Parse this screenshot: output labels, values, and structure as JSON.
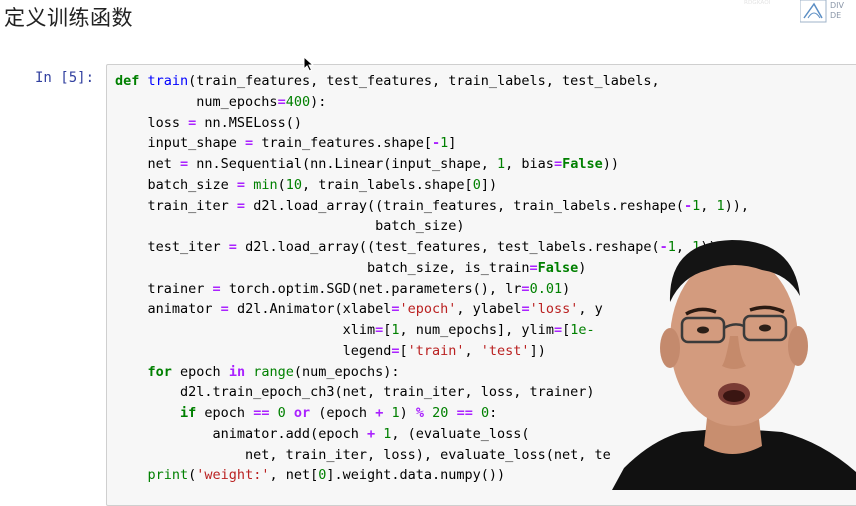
{
  "page": {
    "heading": "定义训练函数",
    "faint_caption": "ᴿᴰᴳᴷᴬᴼᴵ"
  },
  "logo": {
    "text_line1": "DIV",
    "text_line2": "DE"
  },
  "cell": {
    "prompt": "In [5]:",
    "code_lines": [
      [
        {
          "t": "def",
          "c": "kw"
        },
        {
          "t": " ",
          "c": "txt"
        },
        {
          "t": "train",
          "c": "fn"
        },
        {
          "t": "(train_features, test_features, train_labels, test_labels,",
          "c": "txt"
        }
      ],
      [
        {
          "t": "          num_epochs",
          "c": "txt"
        },
        {
          "t": "=",
          "c": "op"
        },
        {
          "t": "400",
          "c": "num"
        },
        {
          "t": "):",
          "c": "txt"
        }
      ],
      [
        {
          "t": "    loss ",
          "c": "txt"
        },
        {
          "t": "=",
          "c": "op"
        },
        {
          "t": " nn.MSELoss()",
          "c": "txt"
        }
      ],
      [
        {
          "t": "    input_shape ",
          "c": "txt"
        },
        {
          "t": "=",
          "c": "op"
        },
        {
          "t": " train_features.shape[",
          "c": "txt"
        },
        {
          "t": "-",
          "c": "op"
        },
        {
          "t": "1",
          "c": "num"
        },
        {
          "t": "]",
          "c": "txt"
        }
      ],
      [
        {
          "t": "    net ",
          "c": "txt"
        },
        {
          "t": "=",
          "c": "op"
        },
        {
          "t": " nn.Sequential(nn.Linear(input_shape, ",
          "c": "txt"
        },
        {
          "t": "1",
          "c": "num"
        },
        {
          "t": ", bias",
          "c": "txt"
        },
        {
          "t": "=",
          "c": "op"
        },
        {
          "t": "False",
          "c": "kw"
        },
        {
          "t": "))",
          "c": "txt"
        }
      ],
      [
        {
          "t": "    batch_size ",
          "c": "txt"
        },
        {
          "t": "=",
          "c": "op"
        },
        {
          "t": " ",
          "c": "txt"
        },
        {
          "t": "min",
          "c": "bi"
        },
        {
          "t": "(",
          "c": "txt"
        },
        {
          "t": "10",
          "c": "num"
        },
        {
          "t": ", train_labels.shape[",
          "c": "txt"
        },
        {
          "t": "0",
          "c": "num"
        },
        {
          "t": "])",
          "c": "txt"
        }
      ],
      [
        {
          "t": "    train_iter ",
          "c": "txt"
        },
        {
          "t": "=",
          "c": "op"
        },
        {
          "t": " d2l.load_array((train_features, train_labels.reshape(",
          "c": "txt"
        },
        {
          "t": "-",
          "c": "op"
        },
        {
          "t": "1",
          "c": "num"
        },
        {
          "t": ", ",
          "c": "txt"
        },
        {
          "t": "1",
          "c": "num"
        },
        {
          "t": ")),",
          "c": "txt"
        }
      ],
      [
        {
          "t": "                                batch_size)",
          "c": "txt"
        }
      ],
      [
        {
          "t": "    test_iter ",
          "c": "txt"
        },
        {
          "t": "=",
          "c": "op"
        },
        {
          "t": " d2l.load_array((test_features, test_labels.reshape(",
          "c": "txt"
        },
        {
          "t": "-",
          "c": "op"
        },
        {
          "t": "1",
          "c": "num"
        },
        {
          "t": ", ",
          "c": "txt"
        },
        {
          "t": "1",
          "c": "num"
        },
        {
          "t": ")),",
          "c": "txt"
        }
      ],
      [
        {
          "t": "                               batch_size, is_train",
          "c": "txt"
        },
        {
          "t": "=",
          "c": "op"
        },
        {
          "t": "False",
          "c": "kw"
        },
        {
          "t": ")",
          "c": "txt"
        }
      ],
      [
        {
          "t": "    trainer ",
          "c": "txt"
        },
        {
          "t": "=",
          "c": "op"
        },
        {
          "t": " torch.optim.SGD(net.parameters(), lr",
          "c": "txt"
        },
        {
          "t": "=",
          "c": "op"
        },
        {
          "t": "0.01",
          "c": "num"
        },
        {
          "t": ")",
          "c": "txt"
        }
      ],
      [
        {
          "t": "    animator ",
          "c": "txt"
        },
        {
          "t": "=",
          "c": "op"
        },
        {
          "t": " d2l.Animator(xlabel",
          "c": "txt"
        },
        {
          "t": "=",
          "c": "op"
        },
        {
          "t": "'epoch'",
          "c": "str"
        },
        {
          "t": ", ylabel",
          "c": "txt"
        },
        {
          "t": "=",
          "c": "op"
        },
        {
          "t": "'loss'",
          "c": "str"
        },
        {
          "t": ", y",
          "c": "txt"
        }
      ],
      [
        {
          "t": "                            xlim",
          "c": "txt"
        },
        {
          "t": "=",
          "c": "op"
        },
        {
          "t": "[",
          "c": "txt"
        },
        {
          "t": "1",
          "c": "num"
        },
        {
          "t": ", num_epochs], ylim",
          "c": "txt"
        },
        {
          "t": "=",
          "c": "op"
        },
        {
          "t": "[",
          "c": "txt"
        },
        {
          "t": "1e-",
          "c": "num"
        }
      ],
      [
        {
          "t": "                            legend",
          "c": "txt"
        },
        {
          "t": "=",
          "c": "op"
        },
        {
          "t": "[",
          "c": "txt"
        },
        {
          "t": "'train'",
          "c": "str"
        },
        {
          "t": ", ",
          "c": "txt"
        },
        {
          "t": "'test'",
          "c": "str"
        },
        {
          "t": "])",
          "c": "txt"
        }
      ],
      [
        {
          "t": "    ",
          "c": "txt"
        },
        {
          "t": "for",
          "c": "kw"
        },
        {
          "t": " epoch ",
          "c": "txt"
        },
        {
          "t": "in",
          "c": "op"
        },
        {
          "t": " ",
          "c": "txt"
        },
        {
          "t": "range",
          "c": "bi"
        },
        {
          "t": "(num_epochs):",
          "c": "txt"
        }
      ],
      [
        {
          "t": "        d2l.train_epoch_ch3(net, train_iter, loss, trainer)",
          "c": "txt"
        }
      ],
      [
        {
          "t": "        ",
          "c": "txt"
        },
        {
          "t": "if",
          "c": "kw"
        },
        {
          "t": " epoch ",
          "c": "txt"
        },
        {
          "t": "==",
          "c": "op"
        },
        {
          "t": " ",
          "c": "txt"
        },
        {
          "t": "0",
          "c": "num"
        },
        {
          "t": " ",
          "c": "txt"
        },
        {
          "t": "or",
          "c": "op"
        },
        {
          "t": " (epoch ",
          "c": "txt"
        },
        {
          "t": "+",
          "c": "op"
        },
        {
          "t": " ",
          "c": "txt"
        },
        {
          "t": "1",
          "c": "num"
        },
        {
          "t": ") ",
          "c": "txt"
        },
        {
          "t": "%",
          "c": "op"
        },
        {
          "t": " ",
          "c": "txt"
        },
        {
          "t": "20",
          "c": "num"
        },
        {
          "t": " ",
          "c": "txt"
        },
        {
          "t": "==",
          "c": "op"
        },
        {
          "t": " ",
          "c": "txt"
        },
        {
          "t": "0",
          "c": "num"
        },
        {
          "t": ":",
          "c": "txt"
        }
      ],
      [
        {
          "t": "            animator.add(epoch ",
          "c": "txt"
        },
        {
          "t": "+",
          "c": "op"
        },
        {
          "t": " ",
          "c": "txt"
        },
        {
          "t": "1",
          "c": "num"
        },
        {
          "t": ", (evaluate_loss(",
          "c": "txt"
        }
      ],
      [
        {
          "t": "                net, train_iter, loss), evaluate_loss(net, te",
          "c": "txt"
        }
      ],
      [
        {
          "t": "    ",
          "c": "txt"
        },
        {
          "t": "print",
          "c": "bi"
        },
        {
          "t": "(",
          "c": "txt"
        },
        {
          "t": "'weight:'",
          "c": "str"
        },
        {
          "t": ", net[",
          "c": "txt"
        },
        {
          "t": "0",
          "c": "num"
        },
        {
          "t": "].weight.data.numpy())",
          "c": "txt"
        }
      ]
    ]
  },
  "colors": {
    "keyword": "#008000",
    "function_name": "#0000ff",
    "string": "#ba2121",
    "operator": "#aa22ff",
    "prompt": "#303f9f",
    "code_background": "#f7f7f7"
  },
  "icons": {
    "cursor": "mouse-pointer-icon",
    "logo": "d2l-logo-icon"
  }
}
